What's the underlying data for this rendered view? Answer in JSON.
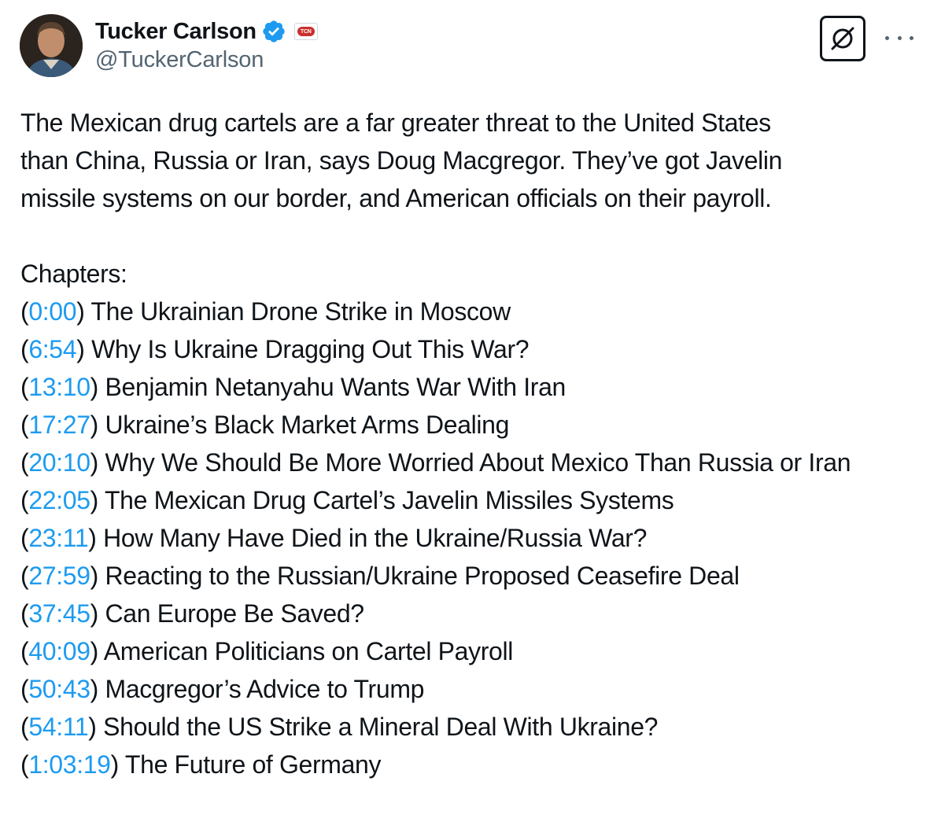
{
  "author": {
    "display_name": "Tucker Carlson",
    "handle": "@TuckerCarlson",
    "affiliate_badge_text": "TCN",
    "verified_color": "#1d9bf0"
  },
  "icons": {
    "verified": "verified-badge-icon",
    "affiliate": "tcn-affiliate-badge-icon",
    "grok": "grok-icon",
    "more": "more-options-icon"
  },
  "tweet": {
    "intro_lines": [
      "The Mexican drug cartels are a far greater threat to the United States",
      "than China, Russia or Iran, says Doug Macgregor. They’ve got Javelin",
      "missile systems on our border, and American officials on their payroll."
    ],
    "chapters_heading": "Chapters:",
    "chapters": [
      {
        "time": "0:00",
        "title": "The Ukrainian Drone Strike in Moscow"
      },
      {
        "time": "6:54",
        "title": "Why Is Ukraine Dragging Out This War?"
      },
      {
        "time": "13:10",
        "title": "Benjamin Netanyahu Wants War With Iran"
      },
      {
        "time": "17:27",
        "title": "Ukraine’s Black Market Arms Dealing"
      },
      {
        "time": "20:10",
        "title": "Why We Should Be More Worried About Mexico Than Russia or Iran"
      },
      {
        "time": "22:05",
        "title": "The Mexican Drug Cartel’s Javelin Missiles Systems"
      },
      {
        "time": "23:11",
        "title": "How Many Have Died in the Ukraine/Russia War?"
      },
      {
        "time": "27:59",
        "title": "Reacting to the Russian/Ukraine Proposed Ceasefire Deal"
      },
      {
        "time": "37:45",
        "title": "Can Europe Be Saved?"
      },
      {
        "time": "40:09",
        "title": "American Politicians on Cartel Payroll"
      },
      {
        "time": "50:43",
        "title": "Macgregor’s Advice to Trump"
      },
      {
        "time": "54:11",
        "title": "Should the US Strike a Mineral Deal With Ukraine?"
      },
      {
        "time": "1:03:19",
        "title": "The Future of Germany"
      }
    ]
  },
  "colors": {
    "text": "#0f1419",
    "secondary": "#536471",
    "link": "#1d9bf0",
    "affiliate_red": "#c9302c"
  }
}
